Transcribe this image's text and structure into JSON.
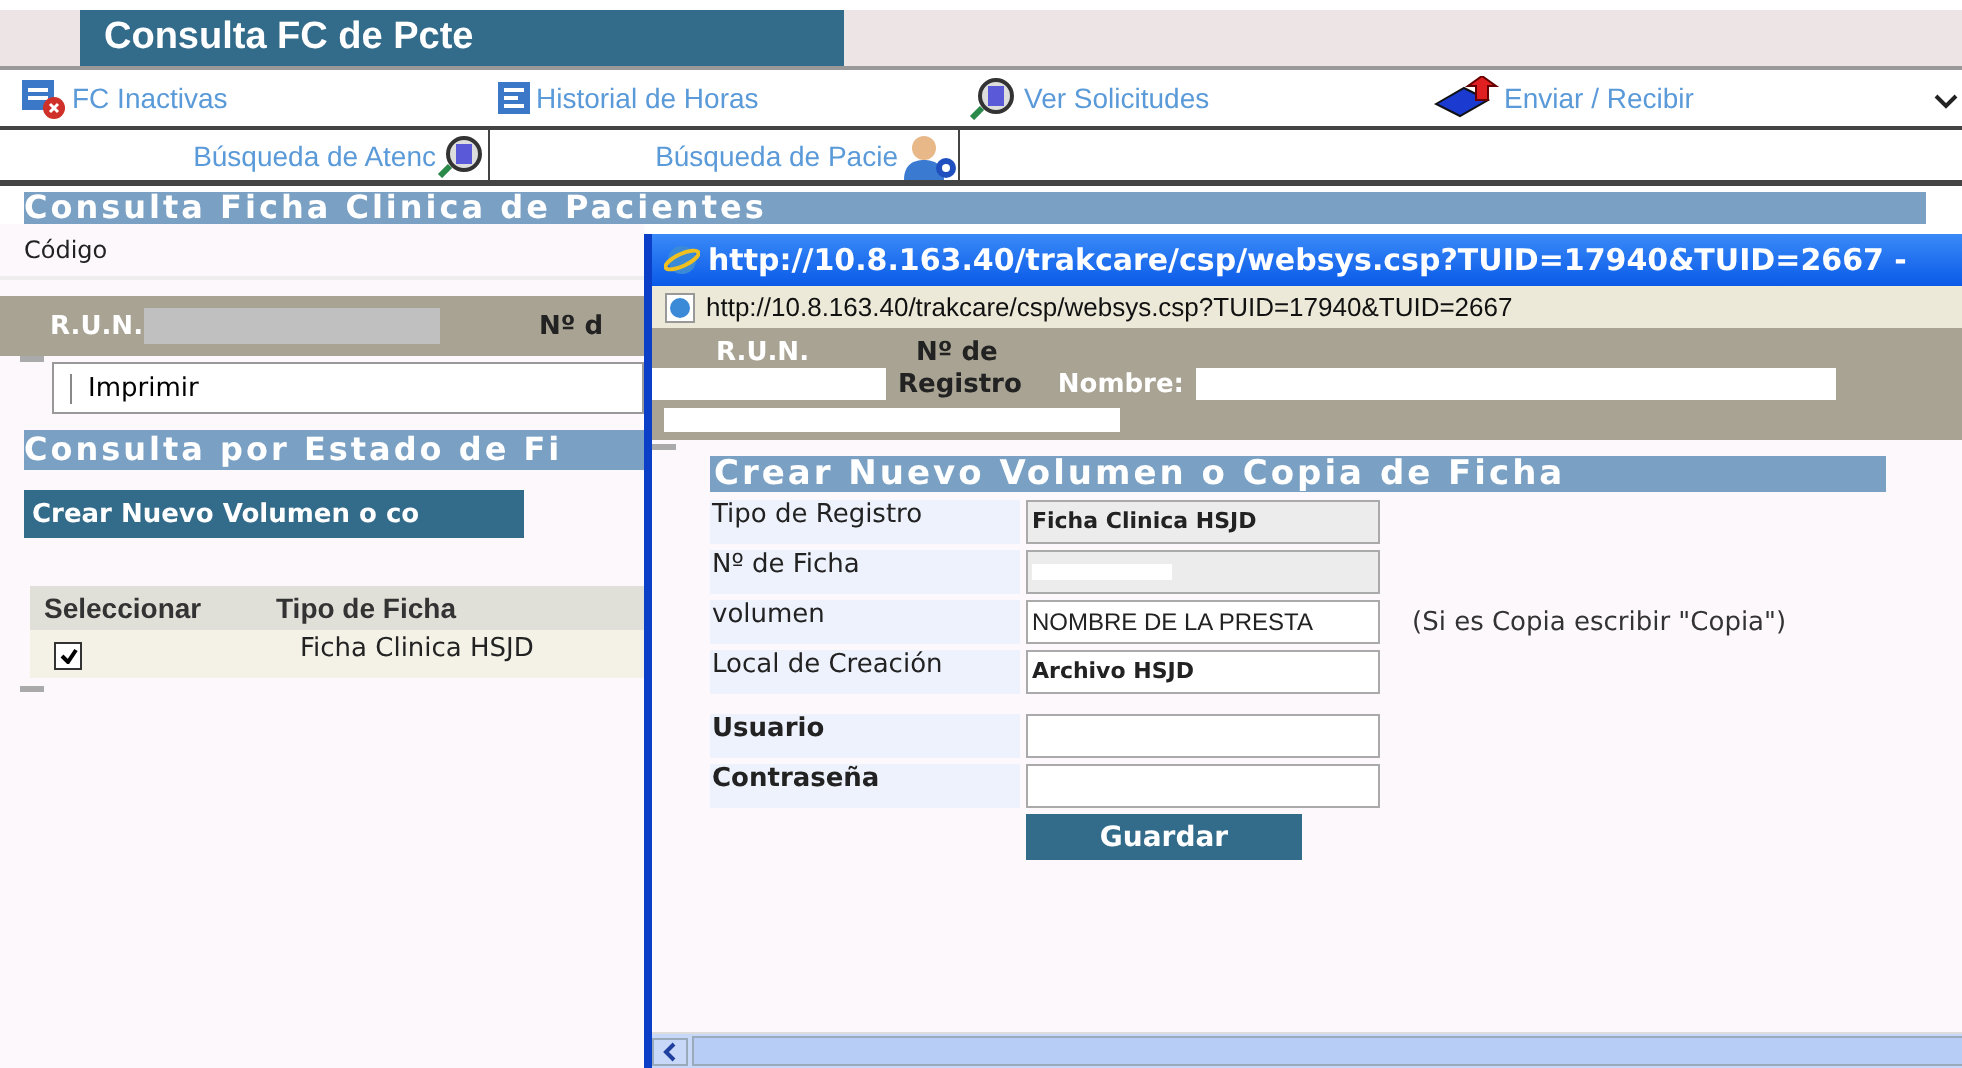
{
  "page": {
    "title": "Consulta FC de Pcte",
    "toolbar": [
      {
        "label": "FC Inactivas"
      },
      {
        "label": "Historial de Horas"
      },
      {
        "label": "Ver Solicitudes"
      },
      {
        "label": "Enviar / Recibir"
      }
    ],
    "search_links": [
      {
        "label": "Búsqueda de Atenc"
      },
      {
        "label": "Búsqueda de Pacie"
      }
    ],
    "section_title": "Consulta Ficha Clinica de Pacientes",
    "code_label": "Código",
    "patient_bar": {
      "run_label": "R.U.N.",
      "registro_label": "Nº d"
    },
    "print_button": "Imprimir",
    "status_title": "Consulta por Estado de Fi",
    "create_button": "Crear Nuevo Volumen o co",
    "table": {
      "columns": [
        "Seleccionar",
        "Tipo de Ficha"
      ],
      "rows": [
        {
          "checked": true,
          "tipo": "Ficha Clinica HSJD"
        }
      ]
    }
  },
  "popup": {
    "title": "http://10.8.163.40/trakcare/csp/websys.csp?TUID=17940&TUID=2667 -",
    "address": "http://10.8.163.40/trakcare/csp/websys.csp?TUID=17940&TUID=2667",
    "patient_bar": {
      "run_label": "R.U.N.",
      "registro_label": "Nº de",
      "registro_label_2": "Registro",
      "nombre_label": "Nombre:"
    },
    "form_title": "Crear Nuevo Volumen o Copia de Ficha",
    "fields": [
      {
        "label": "Tipo de Registro",
        "kind": "readonly",
        "value": "Ficha Clinica HSJD"
      },
      {
        "label": "Nº de Ficha",
        "kind": "redacted"
      },
      {
        "label": "volumen",
        "kind": "input",
        "value": "NOMBRE DE LA PRESTA",
        "note": "(Si es Copia escribir \"Copia\")"
      },
      {
        "label": "Local de Creación",
        "kind": "fixed",
        "value": "Archivo HSJD"
      }
    ],
    "credentials": [
      {
        "label": "Usuario"
      },
      {
        "label": "Contraseña"
      }
    ],
    "save_button": "Guardar"
  }
}
